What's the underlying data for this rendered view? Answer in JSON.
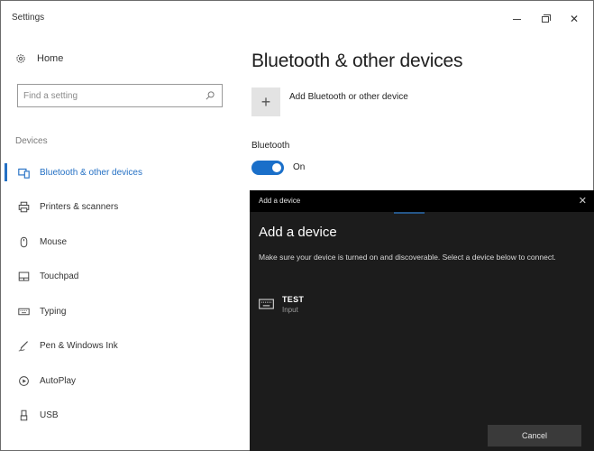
{
  "window": {
    "title": "Settings",
    "controls": {
      "minimize": "",
      "maximize": "",
      "close": "✕"
    }
  },
  "sidebar": {
    "home_label": "Home",
    "search": {
      "placeholder": "Find a setting",
      "value": ""
    },
    "section_label": "Devices",
    "items": [
      {
        "label": "Bluetooth & other devices",
        "icon": "bluetooth-devices-icon",
        "active": true
      },
      {
        "label": "Printers & scanners",
        "icon": "printer-icon",
        "active": false
      },
      {
        "label": "Mouse",
        "icon": "mouse-icon",
        "active": false
      },
      {
        "label": "Touchpad",
        "icon": "touchpad-icon",
        "active": false
      },
      {
        "label": "Typing",
        "icon": "keyboard-icon",
        "active": false
      },
      {
        "label": "Pen & Windows Ink",
        "icon": "pen-icon",
        "active": false
      },
      {
        "label": "AutoPlay",
        "icon": "autoplay-icon",
        "active": false
      },
      {
        "label": "USB",
        "icon": "usb-icon",
        "active": false
      }
    ]
  },
  "main": {
    "title": "Bluetooth & other devices",
    "add_button_symbol": "+",
    "add_label": "Add Bluetooth or other device",
    "bluetooth_label": "Bluetooth",
    "bluetooth_state": "On",
    "bluetooth_on": true
  },
  "dialog": {
    "window_title": "Add a device",
    "close_symbol": "✕",
    "heading": "Add a device",
    "description": "Make sure your device is turned on and discoverable. Select a device below to connect.",
    "devices": [
      {
        "name": "TEST",
        "type": "Input",
        "icon": "keyboard-icon"
      }
    ],
    "cancel_label": "Cancel"
  },
  "colors": {
    "accent": "#2470c4",
    "dialog_bg": "#1c1c1c",
    "dialog_titlebar": "#000000"
  }
}
